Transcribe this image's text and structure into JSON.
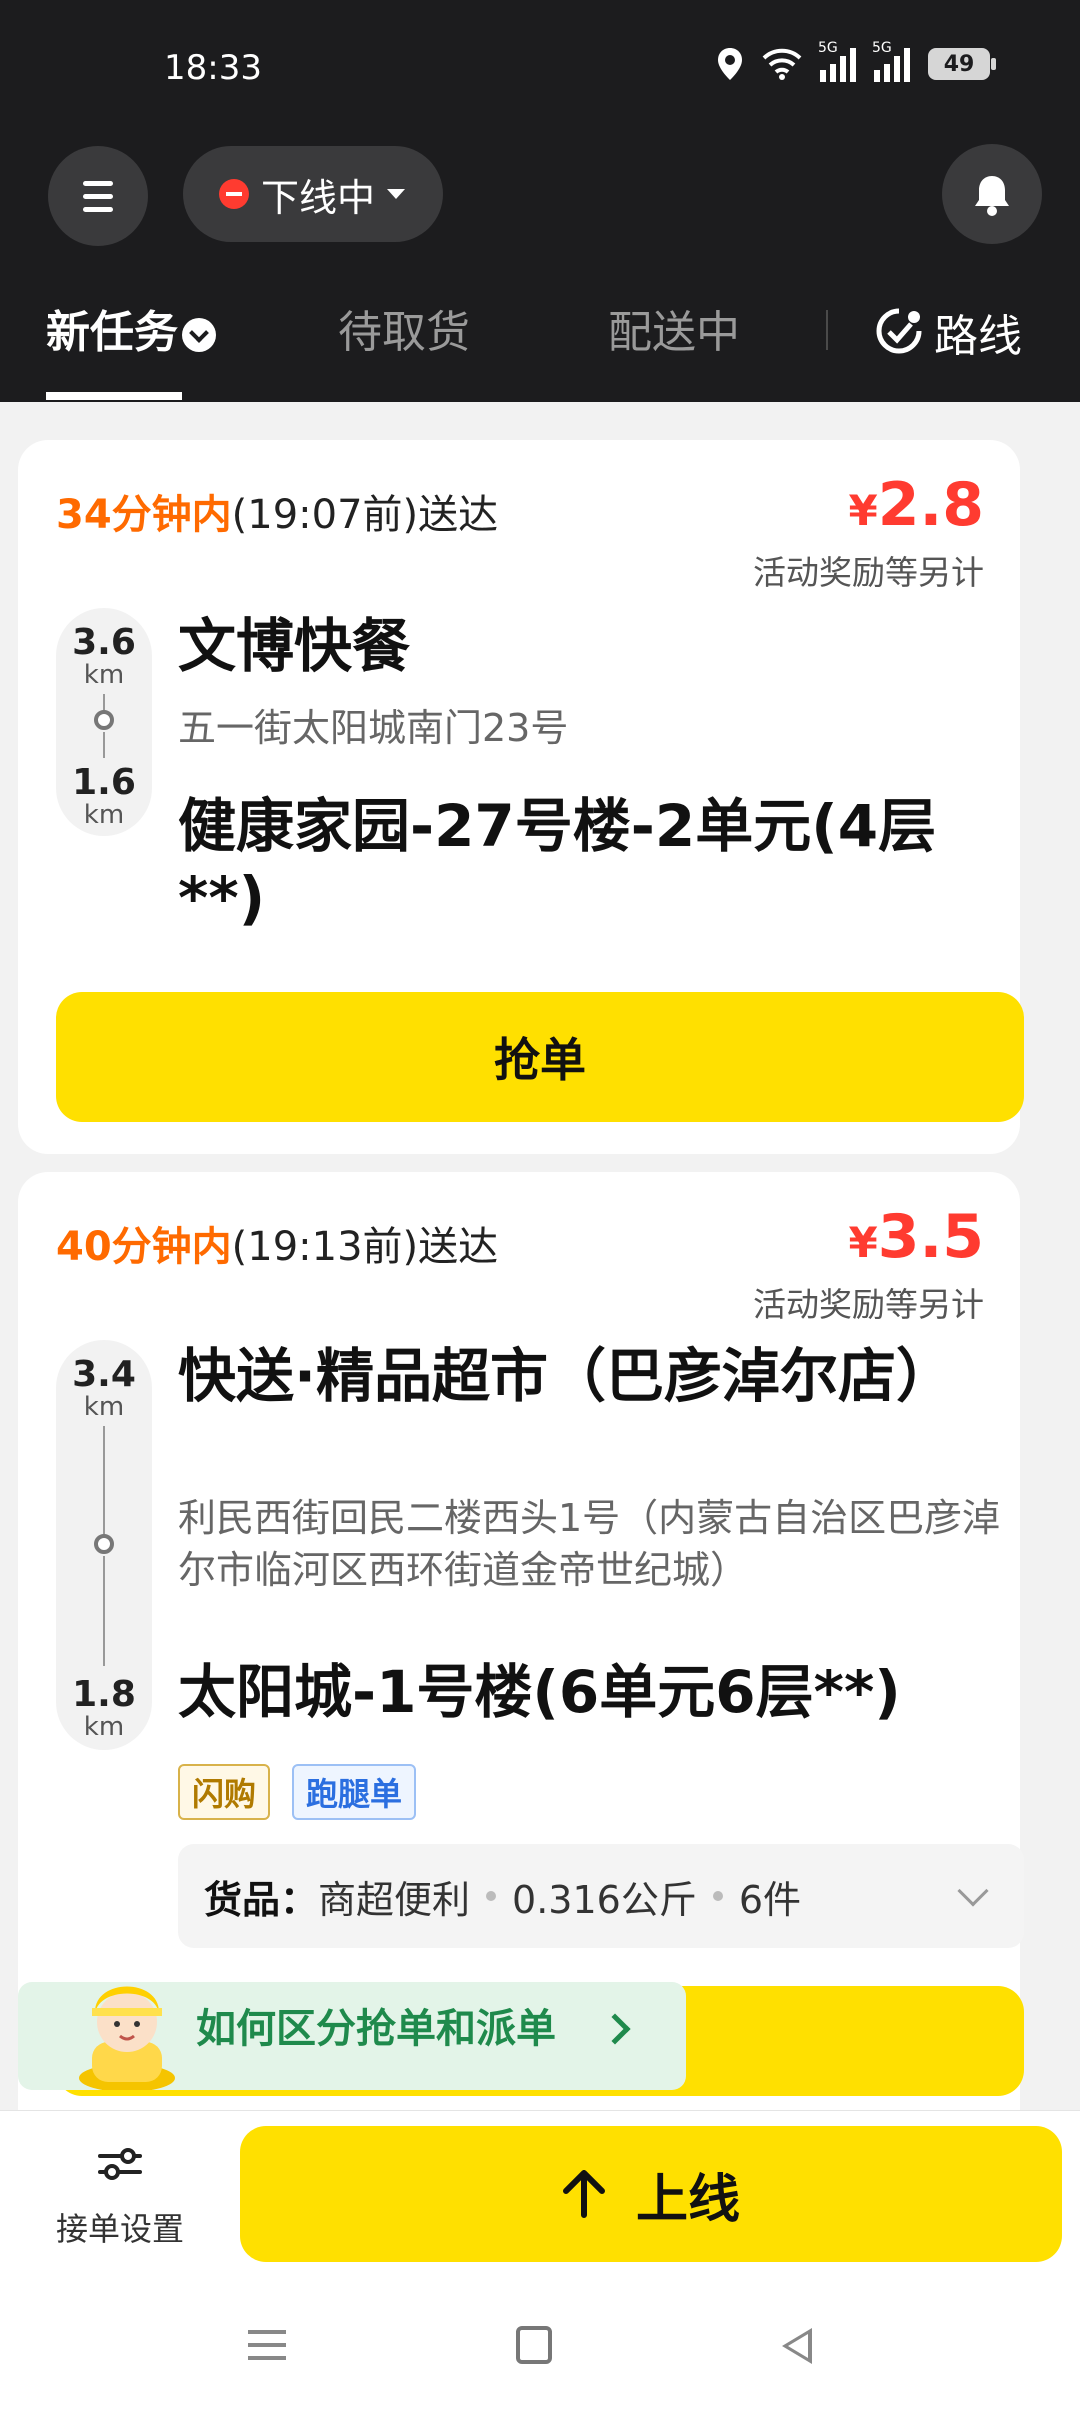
{
  "status_bar": {
    "time": "18:33",
    "network_1": "5G",
    "network_2": "5G",
    "battery": "49",
    "icons": [
      "location-icon",
      "wifi-icon",
      "signal-icon",
      "signal-icon",
      "battery-icon"
    ]
  },
  "header": {
    "online_status": "下线中",
    "tabs": [
      {
        "label": "新任务",
        "active": true
      },
      {
        "label": "待取货",
        "active": false
      },
      {
        "label": "配送中",
        "active": false
      }
    ],
    "route_label": "路线"
  },
  "orders": [
    {
      "eta_highlight": "34分钟内",
      "eta_rest": "(19:07前)送达",
      "price_symbol": "¥",
      "price": "2.8",
      "reward_note": "活动奖励等另计",
      "pickup_distance": "3.6",
      "pickup_unit": "km",
      "shop_name": "文博快餐",
      "shop_address": "五一街太阳城南门23号",
      "dropoff_distance": "1.6",
      "dropoff_unit": "km",
      "destination": "健康家园-27号楼-2单元(4层**)",
      "action_label": "抢单"
    },
    {
      "eta_highlight": "40分钟内",
      "eta_rest": "(19:13前)送达",
      "price_symbol": "¥",
      "price": "3.5",
      "reward_note": "活动奖励等另计",
      "pickup_distance": "3.4",
      "pickup_unit": "km",
      "shop_name": "快送·精品超市（巴彦淖尔店）",
      "shop_address": "利民西街回民二楼西头1号（内蒙古自治区巴彦淖尔市临河区西环街道金帝世纪城）",
      "dropoff_distance": "1.8",
      "dropoff_unit": "km",
      "destination": "太阳城-1号楼(6单元6层**)",
      "tags": [
        "闪购",
        "跑腿单"
      ],
      "goods_label": "货品：",
      "goods_category": "商超便利",
      "goods_weight": "0.316公斤",
      "goods_count": "6件"
    }
  ],
  "banner": {
    "text": "如何区分抢单和派单"
  },
  "bottom": {
    "settings_label": "接单设置",
    "online_label": "上线"
  },
  "colors": {
    "accent_yellow": "#ffe000",
    "eta_orange": "#ff6a00",
    "price_red": "#ff3b30",
    "header_dark": "#1c1c1e"
  }
}
